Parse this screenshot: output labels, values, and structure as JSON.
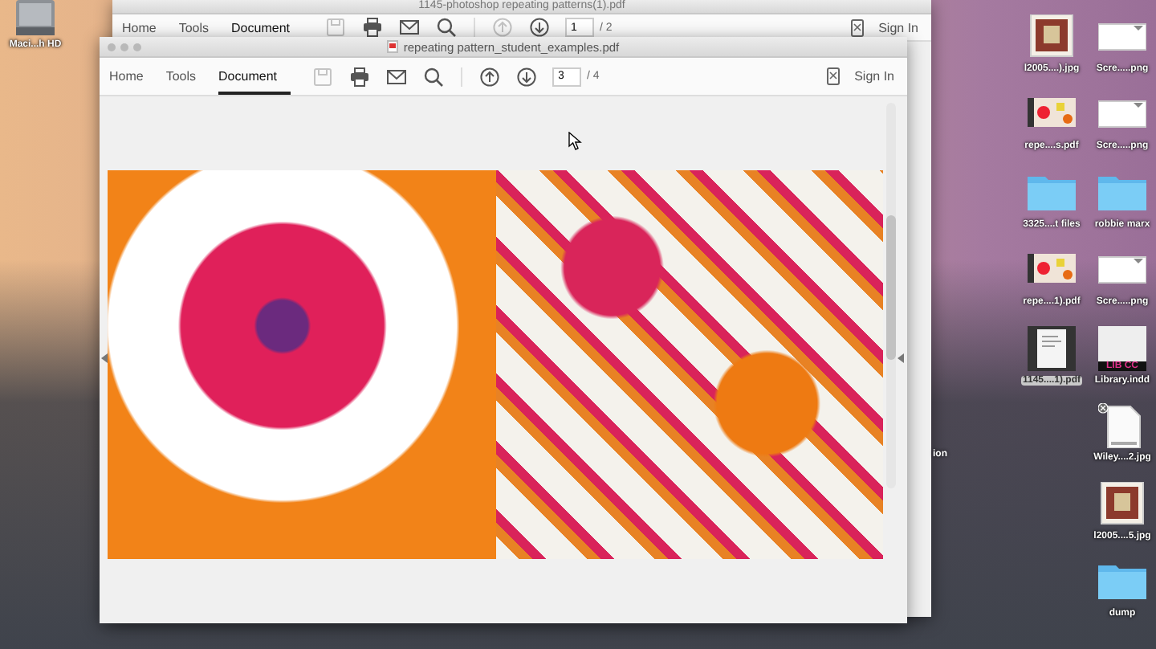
{
  "desktop": {
    "drive": {
      "label": "Maci...h HD"
    },
    "icon_columns": [
      [
        {
          "label": "l2005....).jpg",
          "kind": "photo",
          "selected": false
        },
        {
          "label": "repe....s.pdf",
          "kind": "pdf",
          "selected": false
        },
        {
          "label": "3325....t files",
          "kind": "folder",
          "selected": false
        },
        {
          "label": "repe....1).pdf",
          "kind": "pdf",
          "selected": false
        },
        {
          "label": "1145....1).pdf",
          "kind": "document",
          "selected": true
        }
      ],
      [
        {
          "label": "Scre.....png",
          "kind": "screenshot",
          "selected": false
        },
        {
          "label": "Scre.....png",
          "kind": "screenshot",
          "selected": false
        },
        {
          "label": "robbie marx",
          "kind": "folder",
          "selected": false
        },
        {
          "label": "Scre.....png",
          "kind": "screenshot",
          "selected": false
        },
        {
          "label": "Library.indd",
          "kind": "library",
          "badge": "LIB CC",
          "selected": false
        },
        {
          "label": "Wiley....2.jpg",
          "kind": "file",
          "selected": false
        },
        {
          "label": "l2005....5.jpg",
          "kind": "photo",
          "selected": false
        },
        {
          "label": "dump",
          "kind": "folder",
          "selected": false
        }
      ]
    ],
    "partial_label": "ion"
  },
  "back_window": {
    "title": "1145-photoshop repeating patterns(1).pdf",
    "tabs": [
      {
        "label": "Home",
        "selected": false
      },
      {
        "label": "Tools",
        "selected": false
      },
      {
        "label": "Document",
        "selected": true
      }
    ],
    "tools": [
      {
        "kind": "save",
        "disabled": true
      },
      {
        "kind": "print",
        "disabled": false
      },
      {
        "kind": "mail",
        "disabled": false
      },
      {
        "kind": "search",
        "disabled": false
      },
      {
        "kind": "up",
        "disabled": true
      },
      {
        "kind": "down",
        "disabled": false
      }
    ],
    "page": "1",
    "page_total": "/ 2",
    "sign_in": "Sign In"
  },
  "window": {
    "title": "repeating pattern_student_examples.pdf",
    "tabs": [
      {
        "label": "Home",
        "selected": false
      },
      {
        "label": "Tools",
        "selected": false
      },
      {
        "label": "Document",
        "selected": true
      }
    ],
    "tools": [
      {
        "kind": "save",
        "disabled": true
      },
      {
        "kind": "print",
        "disabled": false
      },
      {
        "kind": "mail",
        "disabled": false
      },
      {
        "kind": "search",
        "disabled": false
      },
      {
        "kind": "up",
        "disabled": false
      },
      {
        "kind": "down",
        "disabled": false
      }
    ],
    "page": "3",
    "page_total": "/ 4",
    "sign_in": "Sign In"
  }
}
